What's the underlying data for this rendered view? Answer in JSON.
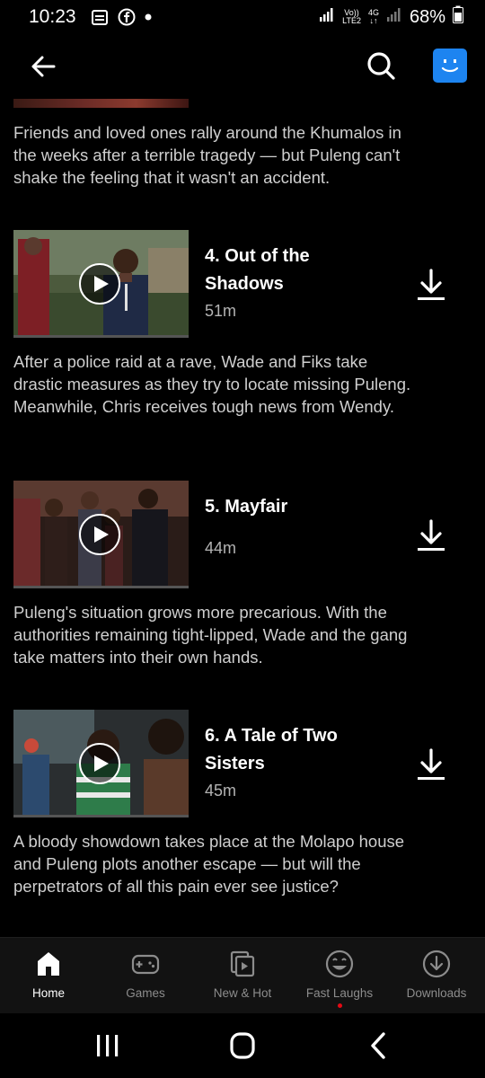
{
  "status_bar": {
    "time": "10:23",
    "network_top": "Vo))",
    "network_bottom": "LTE2",
    "network_type": "4G",
    "battery": "68%",
    "icons": [
      "calendar-icon",
      "facebook-icon",
      "dot-icon",
      "signal-icon",
      "signal-icon",
      "battery-icon"
    ]
  },
  "top_bar": {
    "icons": [
      "back-arrow-icon",
      "search-icon",
      "profile-avatar-icon"
    ],
    "accent": "#1d84f0"
  },
  "episodes": [
    {
      "description": "Friends and loved ones rally around the Khumalos in the weeks after a terrible tragedy — but Puleng can't shake the feeling that it wasn't an accident."
    },
    {
      "title_line1": "4. Out of the",
      "title_line2": "Shadows",
      "duration": "51m",
      "description": "After a police raid at a rave, Wade and Fiks take drastic measures as they try to locate missing Puleng. Meanwhile, Chris receives tough news from Wendy."
    },
    {
      "title_line1": "5. Mayfair",
      "title_line2": "",
      "duration": "44m",
      "description": "Puleng's situation grows more precarious. With the authorities remaining tight-lipped, Wade and the gang take matters into their own hands."
    },
    {
      "title_line1": "6. A Tale of Two",
      "title_line2": "Sisters",
      "duration": "45m",
      "description": "A bloody showdown takes place at the Molapo house and Puleng plots another escape — but will the perpetrators of all this pain ever see justice?"
    }
  ],
  "bottom_nav": {
    "items": [
      {
        "label": "Home",
        "icon": "home-icon",
        "active": true
      },
      {
        "label": "Games",
        "icon": "gamepad-icon",
        "active": false
      },
      {
        "label": "New & Hot",
        "icon": "new-hot-icon",
        "active": false
      },
      {
        "label": "Fast Laughs",
        "icon": "smiley-icon",
        "active": false
      },
      {
        "label": "Downloads",
        "icon": "download-circle-icon",
        "active": false
      }
    ],
    "notification_color": "#e50914"
  },
  "system_nav": {
    "icons": [
      "recents-icon",
      "home-circle-icon",
      "back-chevron-icon"
    ]
  }
}
